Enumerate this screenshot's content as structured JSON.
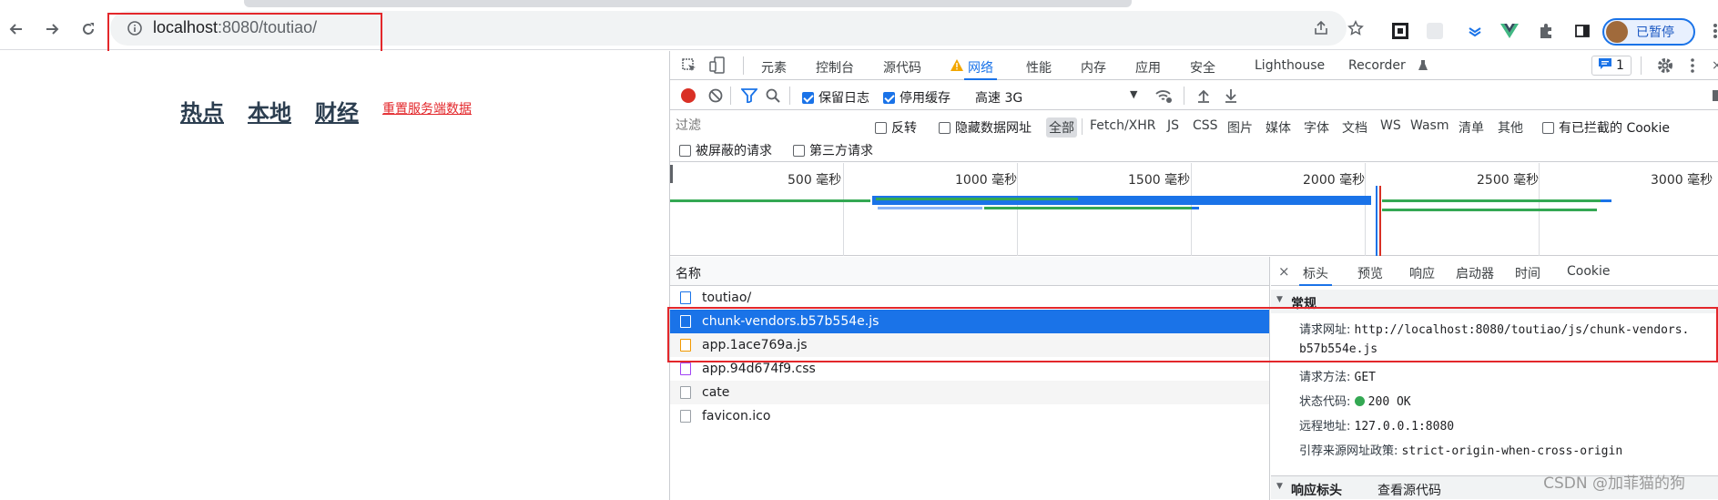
{
  "browser": {
    "url_host": "localhost",
    "url_rest": ":8080/toutiao/",
    "profile_label": "已暂停"
  },
  "page": {
    "nav": [
      "热点",
      "本地",
      "财经"
    ],
    "reset_link": "重置服务端数据"
  },
  "devtools": {
    "tabs": [
      "元素",
      "控制台",
      "源代码",
      "网络",
      "性能",
      "内存",
      "应用",
      "安全",
      "Lighthouse",
      "Recorder"
    ],
    "active_tab": "网络",
    "issues_count": "1",
    "toolbar": {
      "preserve_log": "保留日志",
      "disable_cache": "停用缓存",
      "throttle": "高速 3G"
    },
    "filter": {
      "placeholder": "过滤",
      "invert": "反转",
      "hide_data_urls": "隐藏数据网址",
      "types": [
        "全部",
        "Fetch/XHR",
        "JS",
        "CSS",
        "图片",
        "媒体",
        "字体",
        "文档",
        "WS",
        "Wasm",
        "清单",
        "其他"
      ],
      "blocked_cookies": "有已拦截的 Cookie",
      "blocked_requests": "被屏蔽的请求",
      "third_party": "第三方请求"
    },
    "timeline_ticks": [
      "500 毫秒",
      "1000 毫秒",
      "1500 毫秒",
      "2000 毫秒",
      "2500 毫秒",
      "3000 毫秒"
    ],
    "requests_header": "名称",
    "requests": [
      {
        "name": "toutiao/",
        "icon": "document-icon"
      },
      {
        "name": "chunk-vendors.b57b554e.js",
        "icon": "script-icon"
      },
      {
        "name": "app.1ace769a.js",
        "icon": "script-icon"
      },
      {
        "name": "app.94d674f9.css",
        "icon": "stylesheet-icon"
      },
      {
        "name": "cate",
        "icon": "file-icon"
      },
      {
        "name": "favicon.ico",
        "icon": "file-icon"
      }
    ],
    "selected_request": "chunk-vendors.b57b554e.js",
    "detail_tabs": [
      "标头",
      "预览",
      "响应",
      "启动器",
      "时间",
      "Cookie"
    ],
    "general_section": "常规",
    "general": {
      "request_url_label": "请求网址:",
      "request_url_line1": "http://localhost:8080/toutiao/js/chunk-vendors.",
      "request_url_line2": "b57b554e.js",
      "method_label": "请求方法:",
      "method": "GET",
      "status_label": "状态代码:",
      "status": "200 OK",
      "remote_label": "远程地址:",
      "remote": "127.0.0.1:8080",
      "referrer_label": "引荐来源网址政策:",
      "referrer": "strict-origin-when-cross-origin"
    },
    "response_headers_section": "响应标头",
    "view_source": "查看源代码"
  },
  "watermark": "CSDN @加菲猫的狗",
  "colors": {
    "accent": "#1a73e8",
    "highlight_box": "#e3272b",
    "status_ok": "#34a853"
  }
}
